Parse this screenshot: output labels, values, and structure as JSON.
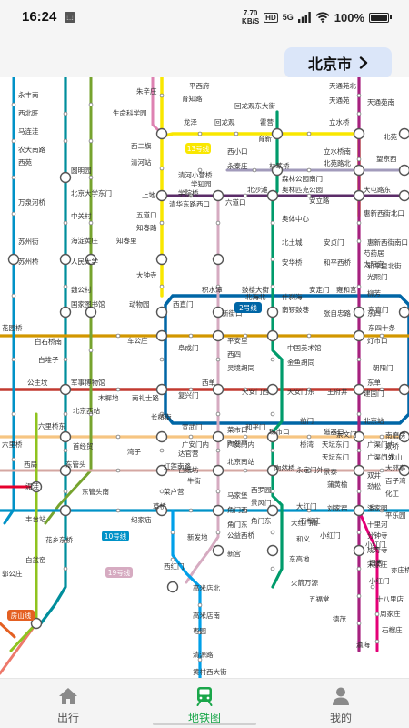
{
  "status_bar": {
    "time": "16:24",
    "app_icon": "notification-icon",
    "net_speed_value": "7.70",
    "net_speed_unit": "KB/S",
    "hd_badge": "HD",
    "signal_label": "5G",
    "battery_percent": "100%",
    "battery_level": 1.0
  },
  "header": {
    "city": "北京市",
    "city_icon": "chevron-right-icon"
  },
  "map": {
    "line_colors": {
      "line1": "#c23a30",
      "line2": "#0066a6",
      "line4": "#008e9c",
      "line5": "#a6217f",
      "line6": "#d29700",
      "line7": "#f6c582",
      "line8": "#009b6b",
      "line9": "#8fc31f",
      "line10": "#0092c7",
      "line13": "#f9e700",
      "line14": "#d4a7a2",
      "line15": "#5b2c68",
      "line16": "#76a32e",
      "line19": "#d6abc1",
      "changping": "#de82b2",
      "fangshan": "#e46022",
      "daxing": "#00a0e9",
      "yizhuang": "#e40077",
      "xijiao": "#e6002d",
      "capital_airport": "#a29bbb",
      "line11": "#ed796b"
    },
    "line_badges": {
      "line13": "13号线",
      "line2": "2号线",
      "line10": "10号线",
      "line19": "19号线",
      "fangshan": "房山线"
    },
    "stations": [
      {
        "id": "yongfeng_nan",
        "name": "永丰南"
      },
      {
        "id": "xibeiwang",
        "name": "西北旺"
      },
      {
        "id": "malianwa",
        "name": "马连洼"
      },
      {
        "id": "nongdananlu",
        "name": "农大南路"
      },
      {
        "id": "xiyuan",
        "name": "西苑"
      },
      {
        "id": "yuanmingyuan",
        "name": "圆明园"
      },
      {
        "id": "wanquanhe",
        "name": "万泉河桥"
      },
      {
        "id": "pkueast",
        "name": "北京大学东门"
      },
      {
        "id": "zhongguancun",
        "name": "中关村"
      },
      {
        "id": "suzhoujie",
        "name": "苏州街"
      },
      {
        "id": "haidianhuangzhuang",
        "name": "海淀黄庄"
      },
      {
        "id": "zhichunli",
        "name": "知春里"
      },
      {
        "id": "suzhouqiao",
        "name": "苏州桥"
      },
      {
        "id": "renmindaxue",
        "name": "人民大学"
      },
      {
        "id": "weigongcun",
        "name": "魏公村"
      },
      {
        "id": "guojiatushuguan",
        "name": "国家图书馆"
      },
      {
        "id": "dongwuyuan",
        "name": "动物园"
      },
      {
        "id": "huayuanqiao",
        "name": "花园桥"
      },
      {
        "id": "baishiqiaonan",
        "name": "白石桥南"
      },
      {
        "id": "baiduizi",
        "name": "白堆子"
      },
      {
        "id": "gongzhufen",
        "name": "公主坟"
      },
      {
        "id": "junshibowuguan",
        "name": "军事博物馆"
      },
      {
        "id": "muxidi",
        "name": "木樨地"
      },
      {
        "id": "nanlishilu",
        "name": "南礼士路"
      },
      {
        "id": "beijingxizhan",
        "name": "北京西站"
      },
      {
        "id": "liulimiao",
        "name": "六里桥东"
      },
      {
        "id": "liuliqiao",
        "name": "六里桥"
      },
      {
        "id": "xiju",
        "name": "西局"
      },
      {
        "id": "dongguantou",
        "name": "东管头"
      },
      {
        "id": "nijiao",
        "name": "泥洼"
      },
      {
        "id": "dongguantounan",
        "name": "东管头南"
      },
      {
        "id": "fengtaizhan",
        "name": "丰台站"
      },
      {
        "id": "shouchuo",
        "name": "首经贸"
      },
      {
        "id": "jijiamiao",
        "name": "纪家庙"
      },
      {
        "id": "huaxiangdongqiao",
        "name": "花乡东桥"
      },
      {
        "id": "baipenyao",
        "name": "白盆窑"
      },
      {
        "id": "guogongzhuang",
        "name": "郭公庄"
      },
      {
        "id": "caoqiao",
        "name": "草桥"
      },
      {
        "id": "zhuxinzhuang",
        "name": "朱辛庄"
      },
      {
        "id": "shengmingkexueyuan",
        "name": "生命科学园"
      },
      {
        "id": "xierqi",
        "name": "西二旗"
      },
      {
        "id": "qinghexiaoying",
        "name": "清河站"
      },
      {
        "id": "shangdi",
        "name": "上地"
      },
      {
        "id": "wudaokou",
        "name": "五道口"
      },
      {
        "id": "zhichunlu",
        "name": "知春路"
      },
      {
        "id": "dazhongsi",
        "name": "大钟寺"
      },
      {
        "id": "xizhimen",
        "name": "西直门"
      },
      {
        "id": "chegongzhuang",
        "name": "车公庄"
      },
      {
        "id": "fuchengmen",
        "name": "阜成门"
      },
      {
        "id": "fuxingmen",
        "name": "复兴门"
      },
      {
        "id": "changchunjie",
        "name": "长椿街"
      },
      {
        "id": "xuanwumen",
        "name": "宣武门"
      },
      {
        "id": "hepingmen",
        "name": "和平门"
      },
      {
        "id": "qianmen",
        "name": "前门"
      },
      {
        "id": "chongwenmen",
        "name": "崇文门"
      },
      {
        "id": "beijingzhan",
        "name": "北京站"
      },
      {
        "id": "jianguomen",
        "name": "建国门"
      },
      {
        "id": "chaoyangmen",
        "name": "朝阳门"
      },
      {
        "id": "dongsishitiao",
        "name": "东四十条"
      },
      {
        "id": "dongzhimen",
        "name": "东直门"
      },
      {
        "id": "yonghegong",
        "name": "雍和宫"
      },
      {
        "id": "andingmen",
        "name": "安定门"
      },
      {
        "id": "guloudajie",
        "name": "鼓楼大街"
      },
      {
        "id": "jishuitan",
        "name": "积水潭"
      },
      {
        "id": "xinjiekou",
        "name": "新街口"
      },
      {
        "id": "pinganli",
        "name": "平安里"
      },
      {
        "id": "xisi",
        "name": "西四"
      },
      {
        "id": "lingjinghutong",
        "name": "灵境胡同"
      },
      {
        "id": "xidan",
        "name": "西单"
      },
      {
        "id": "caishikou",
        "name": "菜市口"
      },
      {
        "id": "taoranting",
        "name": "陶然亭"
      },
      {
        "id": "beijingnanzhan",
        "name": "北京南站"
      },
      {
        "id": "majiapu",
        "name": "马家堡"
      },
      {
        "id": "jiaomenxi",
        "name": "角门西"
      },
      {
        "id": "gongyixiqiao",
        "name": "公益西桥"
      },
      {
        "id": "xinfadi",
        "name": "新发地"
      },
      {
        "id": "xingong",
        "name": "新宫"
      },
      {
        "id": "xihongmen",
        "name": "西红门"
      },
      {
        "id": "gaomidiannan",
        "name": "高米店北"
      },
      {
        "id": "gaomidian",
        "name": "高米店南"
      },
      {
        "id": "zaoyuan",
        "name": "枣园"
      },
      {
        "id": "qingyuanlu",
        "name": "清源路"
      },
      {
        "id": "huangcunxidajie",
        "name": "黄村西大街"
      },
      {
        "id": "pingxifu",
        "name": "平西府"
      },
      {
        "id": "yuzhidong",
        "name": "育知路"
      },
      {
        "id": "huoying",
        "name": "霍营"
      },
      {
        "id": "huilongguandongdajie",
        "name": "回龙观东大街"
      },
      {
        "id": "longze",
        "name": "龙泽"
      },
      {
        "id": "huilongguan",
        "name": "回龙观"
      },
      {
        "id": "lishuiqiao",
        "name": "立水桥"
      },
      {
        "id": "tiantongyuanbei",
        "name": "天通苑北"
      },
      {
        "id": "tiantongyuan",
        "name": "天通苑"
      },
      {
        "id": "tiantongyuannan",
        "name": "天通苑南"
      },
      {
        "id": "lishuiqiaonan",
        "name": "立水桥南"
      },
      {
        "id": "beiyuanlubei",
        "name": "北苑路北"
      },
      {
        "id": "beiyuan",
        "name": "北苑"
      },
      {
        "id": "wangjingxi",
        "name": "望京西"
      },
      {
        "id": "xixiaokou",
        "name": "西小口"
      },
      {
        "id": "yuxin",
        "name": "育新"
      },
      {
        "id": "yongtaizhuang",
        "name": "永泰庄"
      },
      {
        "id": "linchuiqiao",
        "name": "林萃桥"
      },
      {
        "id": "senlingongyuan",
        "name": "森林公园南门"
      },
      {
        "id": "aotizhongxinbei",
        "name": "奥林匹克公园"
      },
      {
        "id": "anli",
        "name": "安立路"
      },
      {
        "id": "datunlu",
        "name": "大屯路东"
      },
      {
        "id": "huixinxijie",
        "name": "惠新西街北口"
      },
      {
        "id": "qinghexiaoyingqiao",
        "name": "清河小营桥"
      },
      {
        "id": "xueyuanqiao",
        "name": "学知园"
      },
      {
        "id": "xueyuanlu",
        "name": "学院桥"
      },
      {
        "id": "qinghuadongluxikou",
        "name": "清华东路西口"
      },
      {
        "id": "liudaokou",
        "name": "六道口"
      },
      {
        "id": "beishatan",
        "name": "北沙滩"
      },
      {
        "id": "aotizhongxin",
        "name": "奥体中心"
      },
      {
        "id": "beitucheng",
        "name": "北土城"
      },
      {
        "id": "anhuaqiao",
        "name": "安华桥"
      },
      {
        "id": "anzhenmen",
        "name": "安贞门"
      },
      {
        "id": "huixindongjie",
        "name": "惠新西街南口"
      },
      {
        "id": "shaoyaoju",
        "name": "芍药居"
      },
      {
        "id": "taiyanggong",
        "name": "太阳宫"
      },
      {
        "id": "guangximen",
        "name": "光熙门"
      },
      {
        "id": "liufang",
        "name": "柳芳"
      },
      {
        "id": "hepingxiqiao",
        "name": "和平西桥"
      },
      {
        "id": "hepingli",
        "name": "和平里北街"
      },
      {
        "id": "dongsi",
        "name": "东四"
      },
      {
        "id": "dengshikou",
        "name": "灯市口"
      },
      {
        "id": "dongdan",
        "name": "东单"
      },
      {
        "id": "wangfujing",
        "name": "王府井"
      },
      {
        "id": "tiananmendong",
        "name": "天安门东"
      },
      {
        "id": "tiananmenxi",
        "name": "天安门西"
      },
      {
        "id": "nanluoguxiang",
        "name": "南锣鼓巷"
      },
      {
        "id": "shichahai",
        "name": "什刹海"
      },
      {
        "id": "beihaibei",
        "name": "北海北"
      },
      {
        "id": "zhangzizhonglu",
        "name": "张自忠路"
      },
      {
        "id": "meishuguan",
        "name": "中国美术馆"
      },
      {
        "id": "jinyuhutong",
        "name": "金鱼胡同"
      },
      {
        "id": "huashiqiao",
        "name": "磁器口"
      },
      {
        "id": "tiantandongmen",
        "name": "天坛东门"
      },
      {
        "id": "zhushikou",
        "name": "珠市口"
      },
      {
        "id": "qiaowan",
        "name": "桥湾"
      },
      {
        "id": "guangqumennei",
        "name": "广渠门内"
      },
      {
        "id": "guangqumenwai",
        "name": "广渠门外"
      },
      {
        "id": "shuangjing",
        "name": "双井"
      },
      {
        "id": "jinsong",
        "name": "劲松"
      },
      {
        "id": "panjiayuan",
        "name": "潘家园"
      },
      {
        "id": "shilihe",
        "name": "十里河"
      },
      {
        "id": "fenzhongsi",
        "name": "分钟寺"
      },
      {
        "id": "chengshousi",
        "name": "成寿寺"
      },
      {
        "id": "songjiazhuang",
        "name": "宋家庄"
      },
      {
        "id": "liujiayao",
        "name": "刘家窑"
      },
      {
        "id": "puhuangyu",
        "name": "蒲黄榆"
      },
      {
        "id": "tiantan",
        "name": "天坛东门"
      },
      {
        "id": "jingtai",
        "name": "景泰"
      },
      {
        "id": "yongdingmenwai",
        "name": "永定门外"
      },
      {
        "id": "taoranqiao",
        "name": "陶然桥"
      },
      {
        "id": "dahongmen",
        "name": "大红门"
      },
      {
        "id": "dahongmennan",
        "name": "大红门南"
      },
      {
        "id": "heyi",
        "name": "和义"
      },
      {
        "id": "dongyuedi",
        "name": "东高地"
      },
      {
        "id": "huojianwanyuan",
        "name": "火箭万源"
      },
      {
        "id": "wufuhuan",
        "name": "五福堂"
      },
      {
        "id": "dejiao",
        "name": "德茂"
      },
      {
        "id": "yinghai",
        "name": "瀛海"
      },
      {
        "id": "xiaocunlu",
        "name": "小红门"
      },
      {
        "id": "jiugong",
        "name": "旧宫"
      },
      {
        "id": "yizhuangqiao",
        "name": "亦庄桥"
      },
      {
        "id": "xiaohongmen",
        "name": "小红门"
      },
      {
        "id": "shibalidian",
        "name": "十八里店"
      },
      {
        "id": "zhoujiazhuang",
        "name": "周家庄"
      },
      {
        "id": "shiliuzhuang",
        "name": "石榴庄"
      },
      {
        "id": "jiaomen",
        "name": "角门东"
      },
      {
        "id": "guangqu",
        "name": "广安门内"
      },
      {
        "id": "dabaotai",
        "name": "达官营"
      },
      {
        "id": "wanshoulu",
        "name": "湾子"
      },
      {
        "id": "baiguanzhuang",
        "name": "白纸坊"
      },
      {
        "id": "niujie",
        "name": "牛街"
      },
      {
        "id": "xuanwumenwai",
        "name": "广安门内"
      },
      {
        "id": "hongmiao",
        "name": "红莲南路"
      },
      {
        "id": "caihuying",
        "name": "菜户营"
      },
      {
        "id": "xiluoyuan",
        "name": "西罗园"
      },
      {
        "id": "majiapubei",
        "name": "景风门"
      },
      {
        "id": "jiaomendong",
        "name": "角门东"
      },
      {
        "id": "shiliuzhuang2",
        "name": "石榴庄"
      },
      {
        "id": "xiaohongmen2",
        "name": "小红门"
      },
      {
        "id": "jiulongshan",
        "name": "九龙山"
      },
      {
        "id": "dajiaoting",
        "name": "大郊亭"
      },
      {
        "id": "baiziwan",
        "name": "百子湾"
      },
      {
        "id": "huagongqiao",
        "name": "化工"
      },
      {
        "id": "nanmofang",
        "name": "南磨房"
      },
      {
        "id": "shuangqiao",
        "name": "双桥"
      },
      {
        "id": "pingleyuan",
        "name": "平乐园"
      }
    ],
    "visible_labels": [
      "永丰南",
      "西北旺",
      "马连洼",
      "农大南路",
      "西苑",
      "圆明园",
      "万泉河桥",
      "北京大学东门",
      "中关村",
      "苏州街",
      "海淀黄庄",
      "知春里",
      "苏州桥",
      "人民大学",
      "魏公村",
      "国家图书馆",
      "动物园",
      "花园桥",
      "白石桥南",
      "白堆子",
      "公主坟",
      "军事博物馆",
      "木樨地",
      "南礼士路",
      "北京西站",
      "六里桥东",
      "六里桥",
      "西局",
      "东管头",
      "泥洼",
      "东管头南",
      "丰台站",
      "首经贸",
      "纪家庙",
      "花乡东桥",
      "白盆窑",
      "郭公庄",
      "草桥",
      "朱辛庄",
      "生命科学园",
      "西二旗",
      "清河站",
      "上地",
      "五道口",
      "知春路",
      "大钟寺",
      "西直门",
      "车公庄",
      "阜成门",
      "复兴门",
      "长椿街",
      "宣武门",
      "和平门",
      "前门",
      "崇文门",
      "北京站",
      "建国门",
      "朝阳门",
      "东四十条",
      "东直门",
      "雍和宫",
      "安定门",
      "鼓楼大街",
      "积水潭",
      "新街口",
      "平安里",
      "西四",
      "灵境胡同",
      "西单",
      "菜市口",
      "陶然亭",
      "北京南站",
      "马家堡",
      "角门西",
      "公益西桥",
      "新发地",
      "新宫",
      "西红门",
      "高米店北",
      "高米店南",
      "枣园",
      "清源路",
      "黄村西大街",
      "平西府",
      "育知路",
      "霍营",
      "回龙观东大街",
      "龙泽",
      "回龙观",
      "立水桥",
      "天通苑北",
      "天通苑",
      "天通苑南",
      "立水桥南",
      "北苑路北",
      "北苑",
      "望京西",
      "西小口",
      "育新",
      "永泰庄",
      "林萃桥",
      "森林公园南门",
      "奥林匹克公园",
      "安立路",
      "大屯路东",
      "惠新西街北口",
      "清河小营桥",
      "学知园",
      "学院桥",
      "清华东路西口",
      "六道口",
      "北沙滩",
      "奥体中心",
      "北土城",
      "安华桥",
      "安贞门",
      "惠新西街南口",
      "芍药居",
      "太阳宫",
      "光熙门",
      "柳芳",
      "和平西桥",
      "和平里北街",
      "东四",
      "灯市口",
      "东单",
      "王府井",
      "天安门东",
      "天安门西",
      "南锣鼓巷",
      "什刹海",
      "北海北",
      "张自忠路",
      "中国美术馆",
      "金鱼胡同",
      "磁器口",
      "天坛东门",
      "珠市口",
      "桥湾",
      "广渠门内",
      "广渠门外",
      "双井",
      "劲松",
      "潘家园",
      "十里河",
      "分钟寺",
      "成寿寺",
      "宋家庄",
      "刘家窑",
      "蒲黄榆",
      "景泰",
      "永定门外",
      "陶然桥",
      "大红门",
      "大红门南",
      "和义",
      "东高地",
      "火箭万源",
      "五福堂",
      "德茂",
      "瀛海",
      "小红门",
      "旧宫",
      "亦庄桥",
      "十八里店",
      "周家庄",
      "石榴庄",
      "角门东",
      "广安门内",
      "达官营",
      "湾子",
      "白纸坊",
      "牛街",
      "红莲南路",
      "菜户营",
      "西罗园",
      "景风门",
      "九龙山",
      "大郊亭",
      "百子湾",
      "化工",
      "南磨房",
      "双桥",
      "平乐园"
    ]
  },
  "tab_bar": {
    "tabs": [
      {
        "label": "出行",
        "icon": "home-icon",
        "active": false
      },
      {
        "label": "地铁图",
        "icon": "subway-icon",
        "active": true
      },
      {
        "label": "我的",
        "icon": "profile-icon",
        "active": false
      }
    ],
    "active_color": "#1aa64a",
    "inactive_color": "#8a8a8a"
  }
}
